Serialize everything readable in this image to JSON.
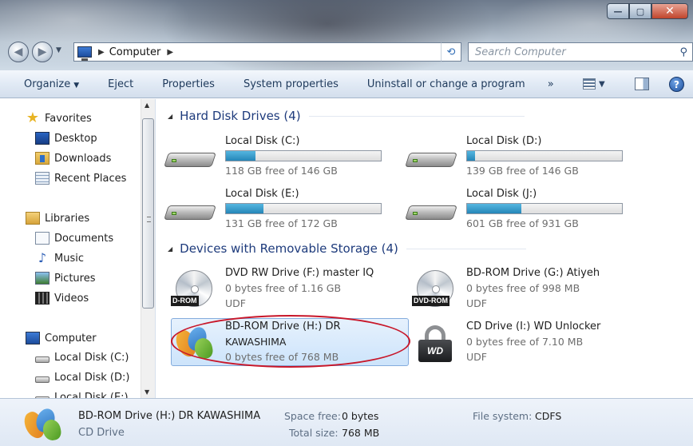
{
  "window": {
    "minimize_symbol": "—",
    "maximize_symbol": "▢",
    "close_symbol": "✕"
  },
  "address_bar": {
    "crumb": "Computer",
    "search_placeholder": "Search Computer"
  },
  "toolbar": {
    "organize": "Organize",
    "eject": "Eject",
    "properties": "Properties",
    "system_properties": "System properties",
    "uninstall": "Uninstall or change a program",
    "more": "»"
  },
  "nav": {
    "favorites": "Favorites",
    "desktop": "Desktop",
    "downloads": "Downloads",
    "recent_places": "Recent Places",
    "libraries": "Libraries",
    "documents": "Documents",
    "music": "Music",
    "pictures": "Pictures",
    "videos": "Videos",
    "computer": "Computer",
    "local_c": "Local Disk (C:)",
    "local_d": "Local Disk (D:)",
    "local_e": "Local Disk (E:)"
  },
  "groups": {
    "hard_disks": "Hard Disk Drives (4)",
    "removable": "Devices with Removable Storage (4)"
  },
  "hard_disks": [
    {
      "name": "Local Disk (C:)",
      "free": "118 GB free of 146 GB",
      "used_fraction": 0.19
    },
    {
      "name": "Local Disk (D:)",
      "free": "139 GB free of 146 GB",
      "used_fraction": 0.05
    },
    {
      "name": "Local Disk (E:)",
      "free": "131 GB free of 172 GB",
      "used_fraction": 0.24
    },
    {
      "name": "Local Disk (J:)",
      "free": "601 GB free of 931 GB",
      "used_fraction": 0.35
    }
  ],
  "removable": {
    "f": {
      "name": "DVD RW Drive (F:) master IQ",
      "line2": "0 bytes free of 1.16 GB",
      "line3": "UDF",
      "badge": "D-ROM"
    },
    "g": {
      "name": "BD-ROM Drive (G:) Atiyeh",
      "line2": "0 bytes free of 998 MB",
      "line3": "UDF",
      "badge": "DVD-ROM"
    },
    "h": {
      "name_line1": "BD-ROM Drive (H:) DR",
      "name_line2": "KAWASHIMA",
      "line2": "0 bytes free of 768 MB"
    },
    "i": {
      "name": "CD Drive (I:) WD Unlocker",
      "line2": "0 bytes free of 7.10 MB",
      "line3": "UDF",
      "badge": "WD"
    }
  },
  "details": {
    "title": "BD-ROM Drive (H:) DR KAWASHIMA",
    "subtitle": "CD Drive",
    "space_free_label": "Space free:",
    "space_free_value": "0 bytes",
    "total_size_label": "Total size:",
    "total_size_value": "768 MB",
    "file_system_label": "File system:",
    "file_system_value": "CDFS"
  }
}
